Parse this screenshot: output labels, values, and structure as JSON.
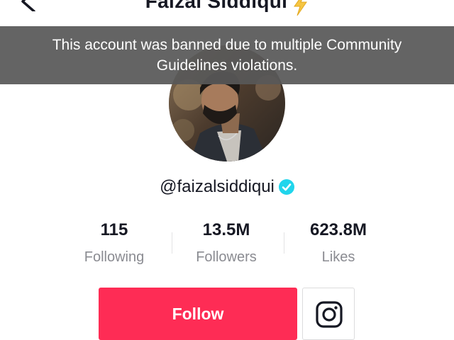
{
  "header": {
    "title": "Faizal Siddiqui",
    "title_emoji": "lightning-icon"
  },
  "banner": {
    "line1": "This account was banned due to multiple Community",
    "line2": "Guidelines violations."
  },
  "profile": {
    "handle": "@faizalsiddiqui",
    "verified": true
  },
  "stats": [
    {
      "value": "115",
      "label": "Following"
    },
    {
      "value": "13.5M",
      "label": "Followers"
    },
    {
      "value": "623.8M",
      "label": "Likes"
    }
  ],
  "actions": {
    "follow_label": "Follow",
    "instagram_icon": "instagram-icon"
  },
  "colors": {
    "accent": "#fe2c55",
    "verified": "#20d5ec",
    "banner_bg": "#585858",
    "text_primary": "#161823",
    "text_secondary": "#8a8b91"
  }
}
